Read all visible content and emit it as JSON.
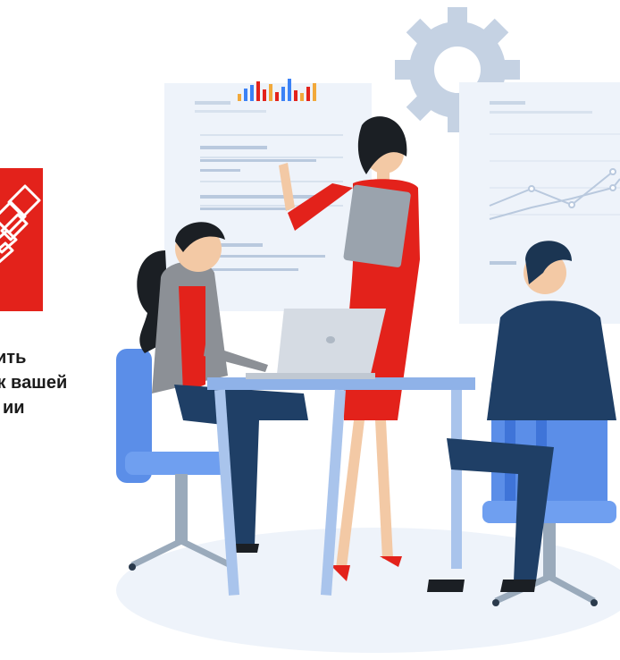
{
  "caption": {
    "line1": "ить",
    "line2": "иж вашей",
    "line3": "ии"
  },
  "icons": {
    "logo": "handshake-logo-icon",
    "gear": "gear-icon",
    "laptop": "laptop-icon"
  },
  "colors": {
    "brand_red": "#e3221b",
    "board_bg": "#eef3fa",
    "gear": "#c5d2e3",
    "navy": "#1f3f66",
    "chair_blue": "#5b8ee8"
  }
}
